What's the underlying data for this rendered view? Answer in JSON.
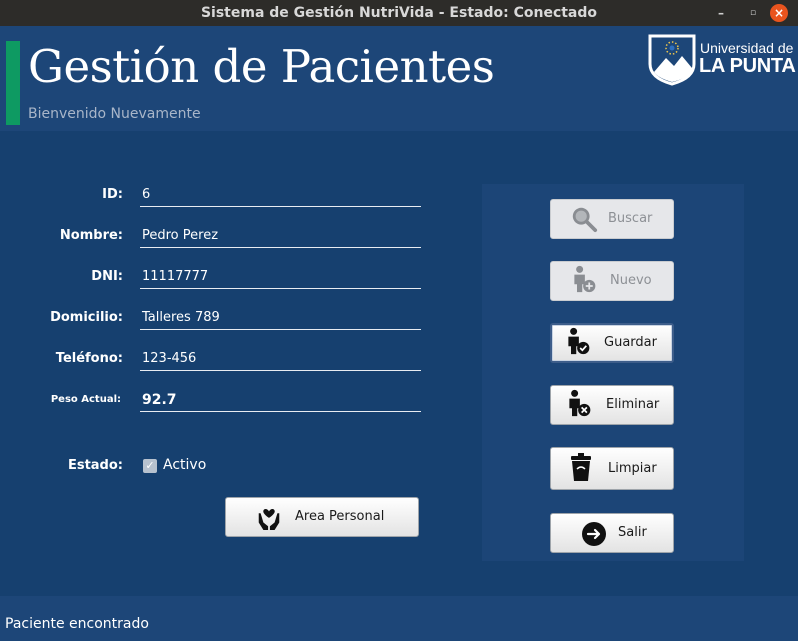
{
  "window": {
    "title": "Sistema de Gestión NutriVida - Estado: Conectado",
    "controls": {
      "minimize": "–",
      "maximize": "▫",
      "close": "×"
    }
  },
  "header": {
    "title": "Gestión de Pacientes",
    "subtitle": "Bienvenido Nuevamente",
    "logo": {
      "line1": "Universidad de",
      "line2": "LA PUNTA"
    }
  },
  "form": {
    "id": {
      "label": "ID:",
      "value": "6"
    },
    "nombre": {
      "label": "Nombre:",
      "value": "Pedro Perez"
    },
    "dni": {
      "label": "DNI:",
      "value": "11117777"
    },
    "domicilio": {
      "label": "Domicilio:",
      "value": "Talleres 789"
    },
    "telefono": {
      "label": "Teléfono:",
      "value": "123-456"
    },
    "peso": {
      "label": "Peso Actual:",
      "value": "92.7"
    },
    "estado": {
      "label": "Estado:",
      "checkbox_label": "Activo",
      "checked": true
    }
  },
  "buttons": {
    "area_personal": "Area Personal",
    "buscar": "Buscar",
    "nuevo": "Nuevo",
    "guardar": "Guardar",
    "eliminar": "Eliminar",
    "limpiar": "Limpiar",
    "salir": "Salir"
  },
  "icons": {
    "buscar": "magnifier-icon",
    "nuevo": "person-add-icon",
    "guardar": "person-check-icon",
    "eliminar": "person-remove-icon",
    "limpiar": "trash-icon",
    "salir": "exit-arrow-icon",
    "area_personal": "hands-heart-icon"
  },
  "status": {
    "message": "Paciente encontrado"
  },
  "colors": {
    "background": "#16406f",
    "header": "#1d4678",
    "accent": "#0e9a62",
    "titlebar": "#2d2c29",
    "close": "#e9541e"
  }
}
